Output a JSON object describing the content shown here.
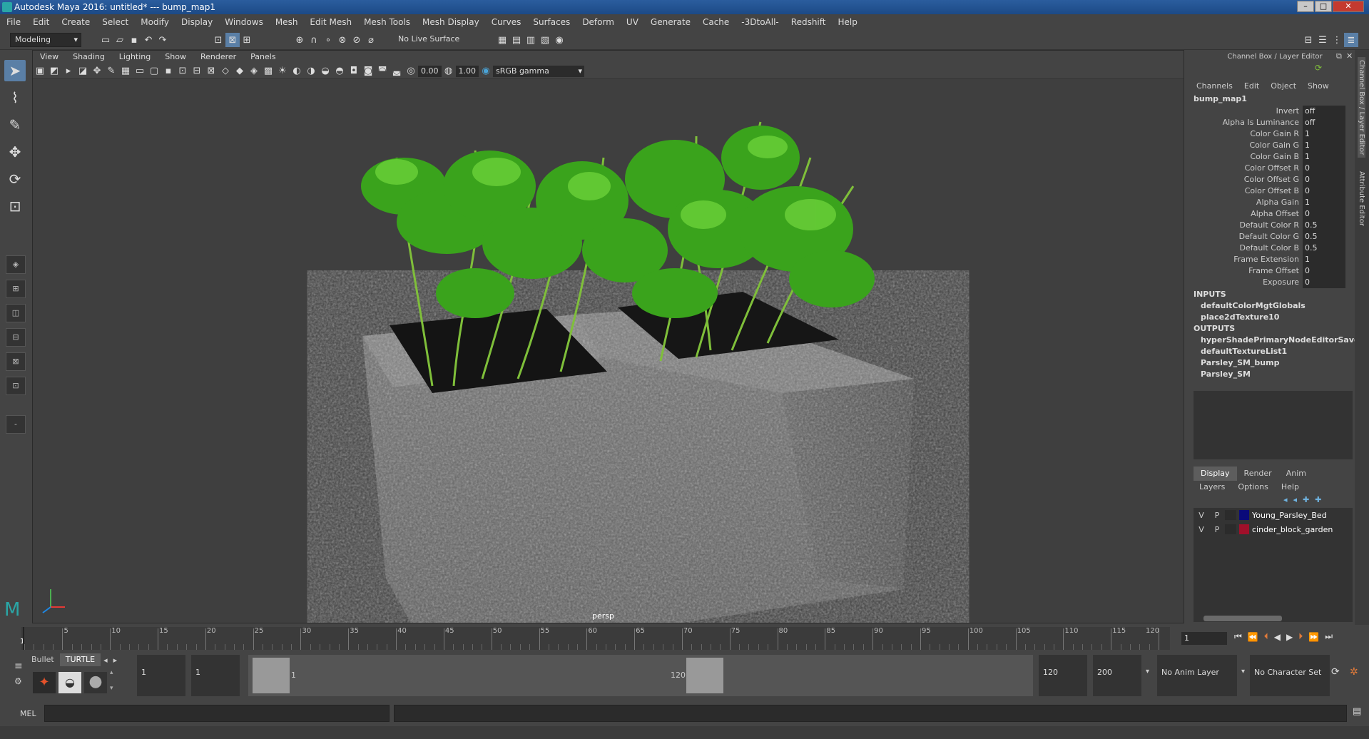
{
  "window": {
    "title": "Autodesk Maya 2016: untitled*   ---   bump_map1"
  },
  "menu": [
    "File",
    "Edit",
    "Create",
    "Select",
    "Modify",
    "Display",
    "Windows",
    "Mesh",
    "Edit Mesh",
    "Mesh Tools",
    "Mesh Display",
    "Curves",
    "Surfaces",
    "Deform",
    "UV",
    "Generate",
    "Cache",
    "-3DtoAll-",
    "Redshift",
    "Help"
  ],
  "status": {
    "mode": "Modeling",
    "live_surface": "No Live Surface"
  },
  "viewport": {
    "menu": [
      "View",
      "Shading",
      "Lighting",
      "Show",
      "Renderer",
      "Panels"
    ],
    "exposure": "0.00",
    "gamma": "1.00",
    "color_space": "sRGB gamma",
    "camera_label": "persp"
  },
  "channel_box": {
    "header": "Channel Box / Layer Editor",
    "menu": [
      "Channels",
      "Edit",
      "Object",
      "Show"
    ],
    "node": "bump_map1",
    "attributes": [
      {
        "label": "Invert",
        "value": "off"
      },
      {
        "label": "Alpha Is Luminance",
        "value": "off"
      },
      {
        "label": "Color Gain R",
        "value": "1"
      },
      {
        "label": "Color Gain G",
        "value": "1"
      },
      {
        "label": "Color Gain B",
        "value": "1"
      },
      {
        "label": "Color Offset R",
        "value": "0"
      },
      {
        "label": "Color Offset G",
        "value": "0"
      },
      {
        "label": "Color Offset B",
        "value": "0"
      },
      {
        "label": "Alpha Gain",
        "value": "1"
      },
      {
        "label": "Alpha Offset",
        "value": "0"
      },
      {
        "label": "Default Color R",
        "value": "0.5"
      },
      {
        "label": "Default Color G",
        "value": "0.5"
      },
      {
        "label": "Default Color B",
        "value": "0.5"
      },
      {
        "label": "Frame Extension",
        "value": "1"
      },
      {
        "label": "Frame Offset",
        "value": "0"
      },
      {
        "label": "Exposure",
        "value": "0"
      }
    ],
    "inputs_label": "INPUTS",
    "inputs": [
      "defaultColorMgtGlobals",
      "place2dTexture10"
    ],
    "outputs_label": "OUTPUTS",
    "outputs": [
      "hyperShadePrimaryNodeEditorSavedT...",
      "defaultTextureList1",
      "Parsley_SM_bump",
      "Parsley_SM"
    ]
  },
  "layer_editor": {
    "tabs": [
      "Display",
      "Render",
      "Anim"
    ],
    "menu": [
      "Layers",
      "Options",
      "Help"
    ],
    "layers": [
      {
        "v": "V",
        "p": "P",
        "name": "Young_Parsley_Bed",
        "color": "#0a0a7a"
      },
      {
        "v": "V",
        "p": "P",
        "name": "cinder_block_garden",
        "color": "#a0102a"
      }
    ]
  },
  "side_tabs": [
    "Channel Box / Layer Editor",
    "Attribute Editor"
  ],
  "timeline": {
    "ticks": [
      "5",
      "10",
      "15",
      "20",
      "25",
      "30",
      "35",
      "40",
      "45",
      "50",
      "55",
      "60",
      "65",
      "70",
      "75",
      "80",
      "85",
      "90",
      "95",
      "100",
      "105",
      "110",
      "115",
      "120"
    ],
    "start_marker": "1",
    "current_frame": "1"
  },
  "range": {
    "shelf_tabs": [
      "Bullet",
      "TURTLE"
    ],
    "start": "1",
    "playback_start": "1",
    "inner_start": "1",
    "inner_end": "120",
    "playback_end": "120",
    "end": "200",
    "anim_layer": "No Anim Layer",
    "character_set": "No Character Set"
  },
  "command": {
    "label": "MEL"
  }
}
